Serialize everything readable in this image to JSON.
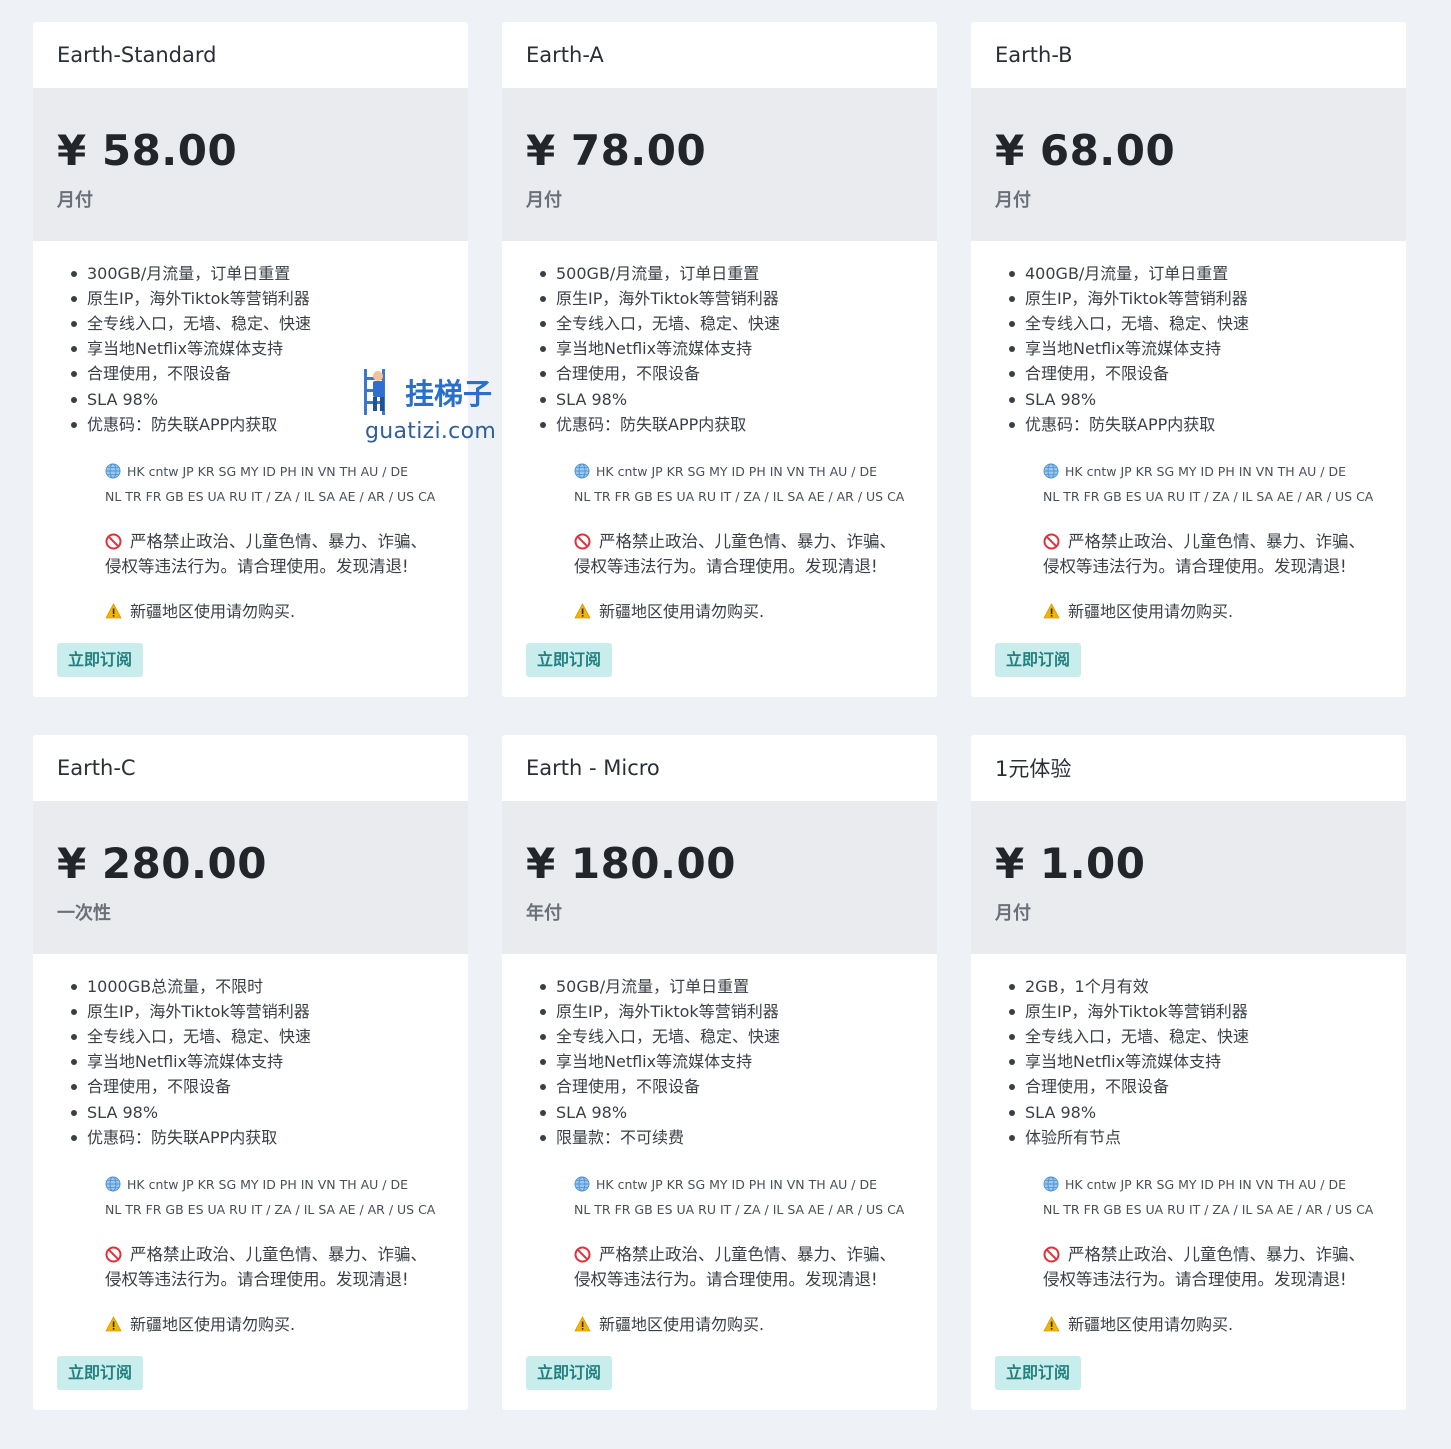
{
  "common": {
    "regions_line1": "HK cntw JP KR SG MY ID PH IN VN TH AU / DE",
    "regions_line2": "NL TR FR GB ES UA RU IT / ZA / IL SA AE / AR / US CA",
    "ban_line1": "严格禁止政治、儿童色情、暴力、诈骗、",
    "ban_line2": "侵权等违法行为。请合理使用。发现清退!",
    "xinjiang_notice": "新疆地区使用请勿购买.",
    "subscribe_label": "立即订阅"
  },
  "watermark": {
    "title": "挂梯子",
    "url": "guatizi.com"
  },
  "plans": [
    {
      "name": "Earth-Standard",
      "price": "¥ 58.00",
      "period": "月付",
      "features": [
        "300GB/月流量，订单日重置",
        "原生IP，海外Tiktok等营销利器",
        "全专线入口，无墙、稳定、快速",
        "享当地Netflix等流媒体支持",
        "合理使用，不限设备",
        "SLA 98%",
        "优惠码：防失联APP内获取"
      ]
    },
    {
      "name": "Earth-A",
      "price": "¥ 78.00",
      "period": "月付",
      "features": [
        "500GB/月流量，订单日重置",
        "原生IP，海外Tiktok等营销利器",
        "全专线入口，无墙、稳定、快速",
        "享当地Netflix等流媒体支持",
        "合理使用，不限设备",
        "SLA 98%",
        "优惠码：防失联APP内获取"
      ]
    },
    {
      "name": "Earth-B",
      "price": "¥ 68.00",
      "period": "月付",
      "features": [
        "400GB/月流量，订单日重置",
        "原生IP，海外Tiktok等营销利器",
        "全专线入口，无墙、稳定、快速",
        "享当地Netflix等流媒体支持",
        "合理使用，不限设备",
        "SLA 98%",
        "优惠码：防失联APP内获取"
      ]
    },
    {
      "name": "Earth-C",
      "price": "¥ 280.00",
      "period": "一次性",
      "features": [
        "1000GB总流量，不限时",
        "原生IP，海外Tiktok等营销利器",
        "全专线入口，无墙、稳定、快速",
        "享当地Netflix等流媒体支持",
        "合理使用，不限设备",
        "SLA 98%",
        "优惠码：防失联APP内获取"
      ]
    },
    {
      "name": "Earth - Micro",
      "price": "¥ 180.00",
      "period": "年付",
      "features": [
        "50GB/月流量，订单日重置",
        "原生IP，海外Tiktok等营销利器",
        "全专线入口，无墙、稳定、快速",
        "享当地Netflix等流媒体支持",
        "合理使用，不限设备",
        "SLA 98%",
        "限量款：不可续费"
      ]
    },
    {
      "name": "1元体验",
      "price": "¥ 1.00",
      "period": "月付",
      "features": [
        "2GB，1个月有效",
        "原生IP，海外Tiktok等营销利器",
        "全专线入口，无墙、稳定、快速",
        "享当地Netflix等流媒体支持",
        "合理使用，不限设备",
        "SLA 98%",
        "体验所有节点"
      ]
    }
  ]
}
